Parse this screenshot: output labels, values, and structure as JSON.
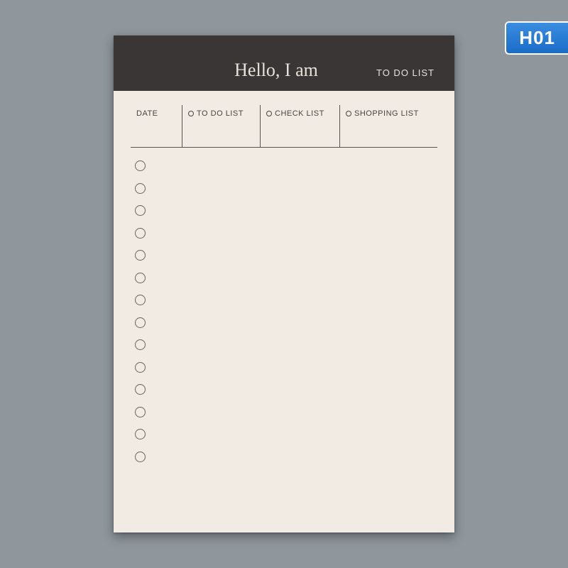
{
  "badge": {
    "label": "H01"
  },
  "notepad": {
    "header": {
      "title": "Hello, I am",
      "subtitle": "TO DO LIST"
    },
    "columns": {
      "date": "DATE",
      "todo": "TO DO LIST",
      "check": "CHECK LIST",
      "shop": "SHOPPING LIST"
    },
    "bullet_count": 14
  }
}
